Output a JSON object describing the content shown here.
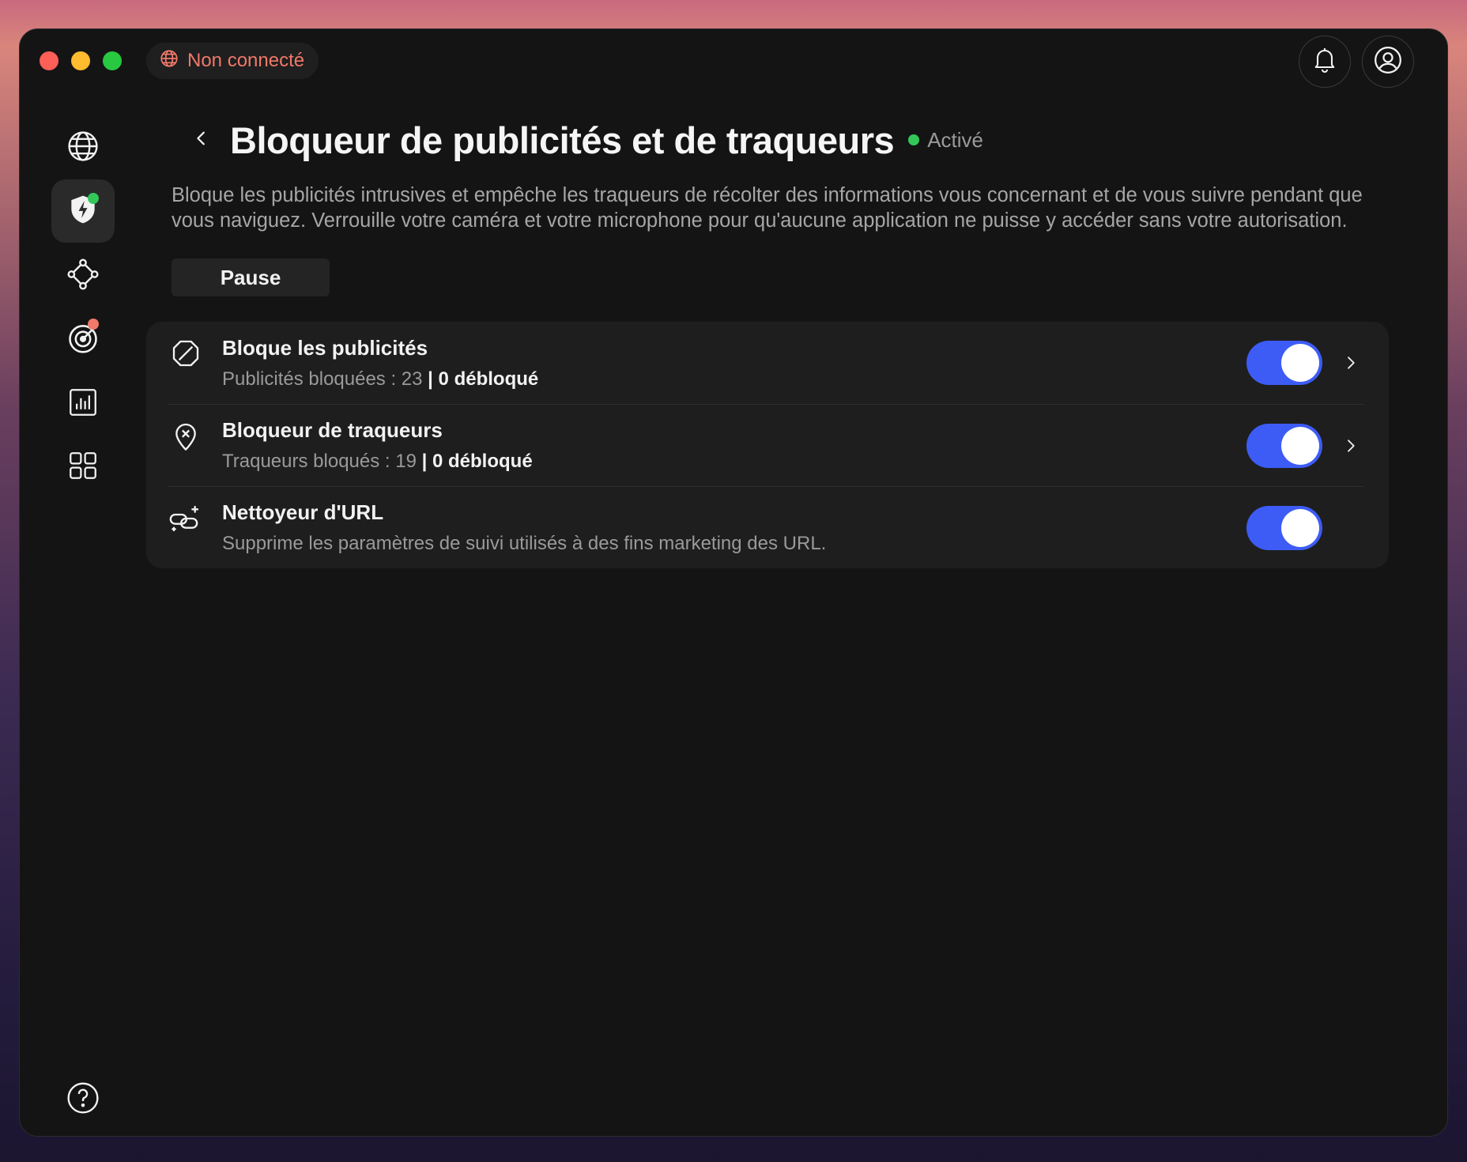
{
  "titlebar": {
    "connection_status": "Non connecté",
    "connection_color": "#f0796a"
  },
  "sidebar": {
    "items": [
      {
        "icon": "globe-icon"
      },
      {
        "icon": "shield-bolt-icon",
        "active": true,
        "badge_color": "#33c759"
      },
      {
        "icon": "mesh-network-icon"
      },
      {
        "icon": "radar-target-icon",
        "badge_color": "#f0796a"
      },
      {
        "icon": "bar-chart-icon"
      },
      {
        "icon": "apps-grid-icon"
      }
    ],
    "help_icon": "help-icon"
  },
  "page": {
    "title": "Bloqueur de publicités et de traqueurs",
    "state": "Activé",
    "description": "Bloque les publicités intrusives et empêche les traqueurs de récolter des informations vous concernant et de vous suivre pendant que vous naviguez. Verrouille votre caméra et votre microphone pour qu'aucune application ne puisse y accéder sans votre autorisation.",
    "pause_label": "Pause"
  },
  "features": [
    {
      "title": "Bloque les publicités",
      "stat_label": "Publicités bloquées : 23",
      "stat_extra": "| 0 débloqué",
      "enabled": true
    },
    {
      "title": "Bloqueur de traqueurs",
      "stat_label": "Traqueurs bloqués : 19",
      "stat_extra": "| 0 débloqué",
      "enabled": true
    },
    {
      "title": "Nettoyeur d'URL",
      "stat_label": "Supprime les paramètres de suivi utilisés à des fins marketing des URL.",
      "stat_extra": "",
      "enabled": true
    }
  ],
  "colors": {
    "accent": "#3d5cf5",
    "active_green": "#33c759"
  }
}
